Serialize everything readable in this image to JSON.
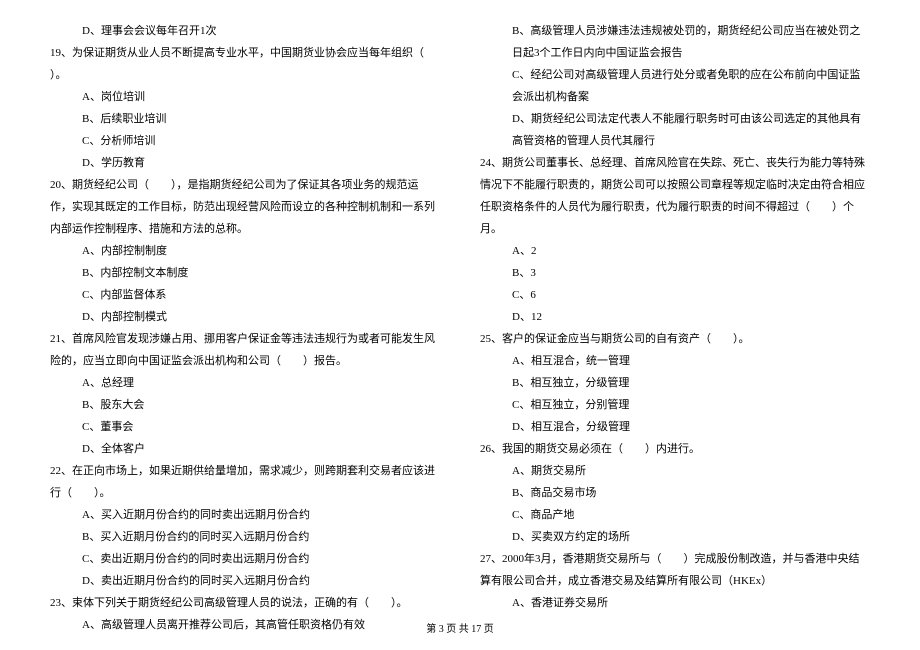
{
  "left": [
    {
      "cls": "indent-1",
      "text": "D、理事会会议每年召开1次"
    },
    {
      "cls": "indent-0",
      "text": "19、为保证期货从业人员不断提高专业水平，中国期货业协会应当每年组织（　　）。"
    },
    {
      "cls": "indent-1",
      "text": "A、岗位培训"
    },
    {
      "cls": "indent-1",
      "text": "B、后续职业培训"
    },
    {
      "cls": "indent-1",
      "text": "C、分析师培训"
    },
    {
      "cls": "indent-1",
      "text": "D、学历教育"
    },
    {
      "cls": "indent-0",
      "text": "20、期货经纪公司（　　），是指期货经纪公司为了保证其各项业务的规范运作，实现其既定的工作目标，防范出现经营风险而设立的各种控制机制和一系列内部运作控制程序、措施和方法的总称。"
    },
    {
      "cls": "indent-1",
      "text": "A、内部控制制度"
    },
    {
      "cls": "indent-1",
      "text": "B、内部控制文本制度"
    },
    {
      "cls": "indent-1",
      "text": "C、内部监督体系"
    },
    {
      "cls": "indent-1",
      "text": "D、内部控制模式"
    },
    {
      "cls": "indent-0",
      "text": "21、首席风险官发现涉嫌占用、挪用客户保证金等违法违规行为或者可能发生风险的，应当立即向中国证监会派出机构和公司（　　）报告。"
    },
    {
      "cls": "indent-1",
      "text": "A、总经理"
    },
    {
      "cls": "indent-1",
      "text": "B、股东大会"
    },
    {
      "cls": "indent-1",
      "text": "C、董事会"
    },
    {
      "cls": "indent-1",
      "text": "D、全体客户"
    },
    {
      "cls": "indent-0",
      "text": "22、在正向市场上，如果近期供给量增加，需求减少，则跨期套利交易者应该进行（　　）。"
    },
    {
      "cls": "indent-1",
      "text": "A、买入近期月份合约的同时卖出远期月份合约"
    },
    {
      "cls": "indent-1",
      "text": "B、买入近期月份合约的同时买入远期月份合约"
    },
    {
      "cls": "indent-1",
      "text": "C、卖出近期月份合约的同时卖出远期月份合约"
    },
    {
      "cls": "indent-1",
      "text": "D、卖出近期月份合约的同时买入远期月份合约"
    },
    {
      "cls": "indent-0",
      "text": "23、束体下列关于期货经纪公司高级管理人员的说法，正确的有（　　）。"
    },
    {
      "cls": "indent-1",
      "text": "A、高级管理人员离开推荐公司后，其高管任职资格仍有效"
    }
  ],
  "right": [
    {
      "cls": "indent-1",
      "text": "B、高级管理人员涉嫌违法违规被处罚的，期货经纪公司应当在被处罚之日起3个工作日内向中国证监会报告"
    },
    {
      "cls": "indent-1",
      "text": "C、经纪公司对高级管理人员进行处分或者免职的应在公布前向中国证监会派出机构备案"
    },
    {
      "cls": "indent-1",
      "text": "D、期货经纪公司法定代表人不能履行职务时可由该公司选定的其他具有高管资格的管理人员代其履行"
    },
    {
      "cls": "indent-0",
      "text": "24、期货公司董事长、总经理、首席风险官在失踪、死亡、丧失行为能力等特殊情况下不能履行职责的，期货公司可以按照公司章程等规定临时决定由符合相应任职资格条件的人员代为履行职责，代为履行职责的时间不得超过（　　）个月。"
    },
    {
      "cls": "indent-1",
      "text": "A、2"
    },
    {
      "cls": "indent-1",
      "text": "B、3"
    },
    {
      "cls": "indent-1",
      "text": "C、6"
    },
    {
      "cls": "indent-1",
      "text": "D、12"
    },
    {
      "cls": "indent-0",
      "text": "25、客户的保证金应当与期货公司的自有资产（　　）。"
    },
    {
      "cls": "indent-1",
      "text": "A、相互混合，统一管理"
    },
    {
      "cls": "indent-1",
      "text": "B、相互独立，分级管理"
    },
    {
      "cls": "indent-1",
      "text": "C、相互独立，分别管理"
    },
    {
      "cls": "indent-1",
      "text": "D、相互混合，分级管理"
    },
    {
      "cls": "indent-0",
      "text": "26、我国的期货交易必须在（　　）内进行。"
    },
    {
      "cls": "indent-1",
      "text": "A、期货交易所"
    },
    {
      "cls": "indent-1",
      "text": "B、商品交易市场"
    },
    {
      "cls": "indent-1",
      "text": "C、商品产地"
    },
    {
      "cls": "indent-1",
      "text": "D、买卖双方约定的场所"
    },
    {
      "cls": "indent-0",
      "text": "27、2000年3月，香港期货交易所与（　　）完成股份制改造，并与香港中央结算有限公司合并，成立香港交易及结算所有限公司（HKEx）"
    },
    {
      "cls": "indent-1",
      "text": "A、香港证券交易所"
    }
  ],
  "footer": "第 3 页 共 17 页"
}
